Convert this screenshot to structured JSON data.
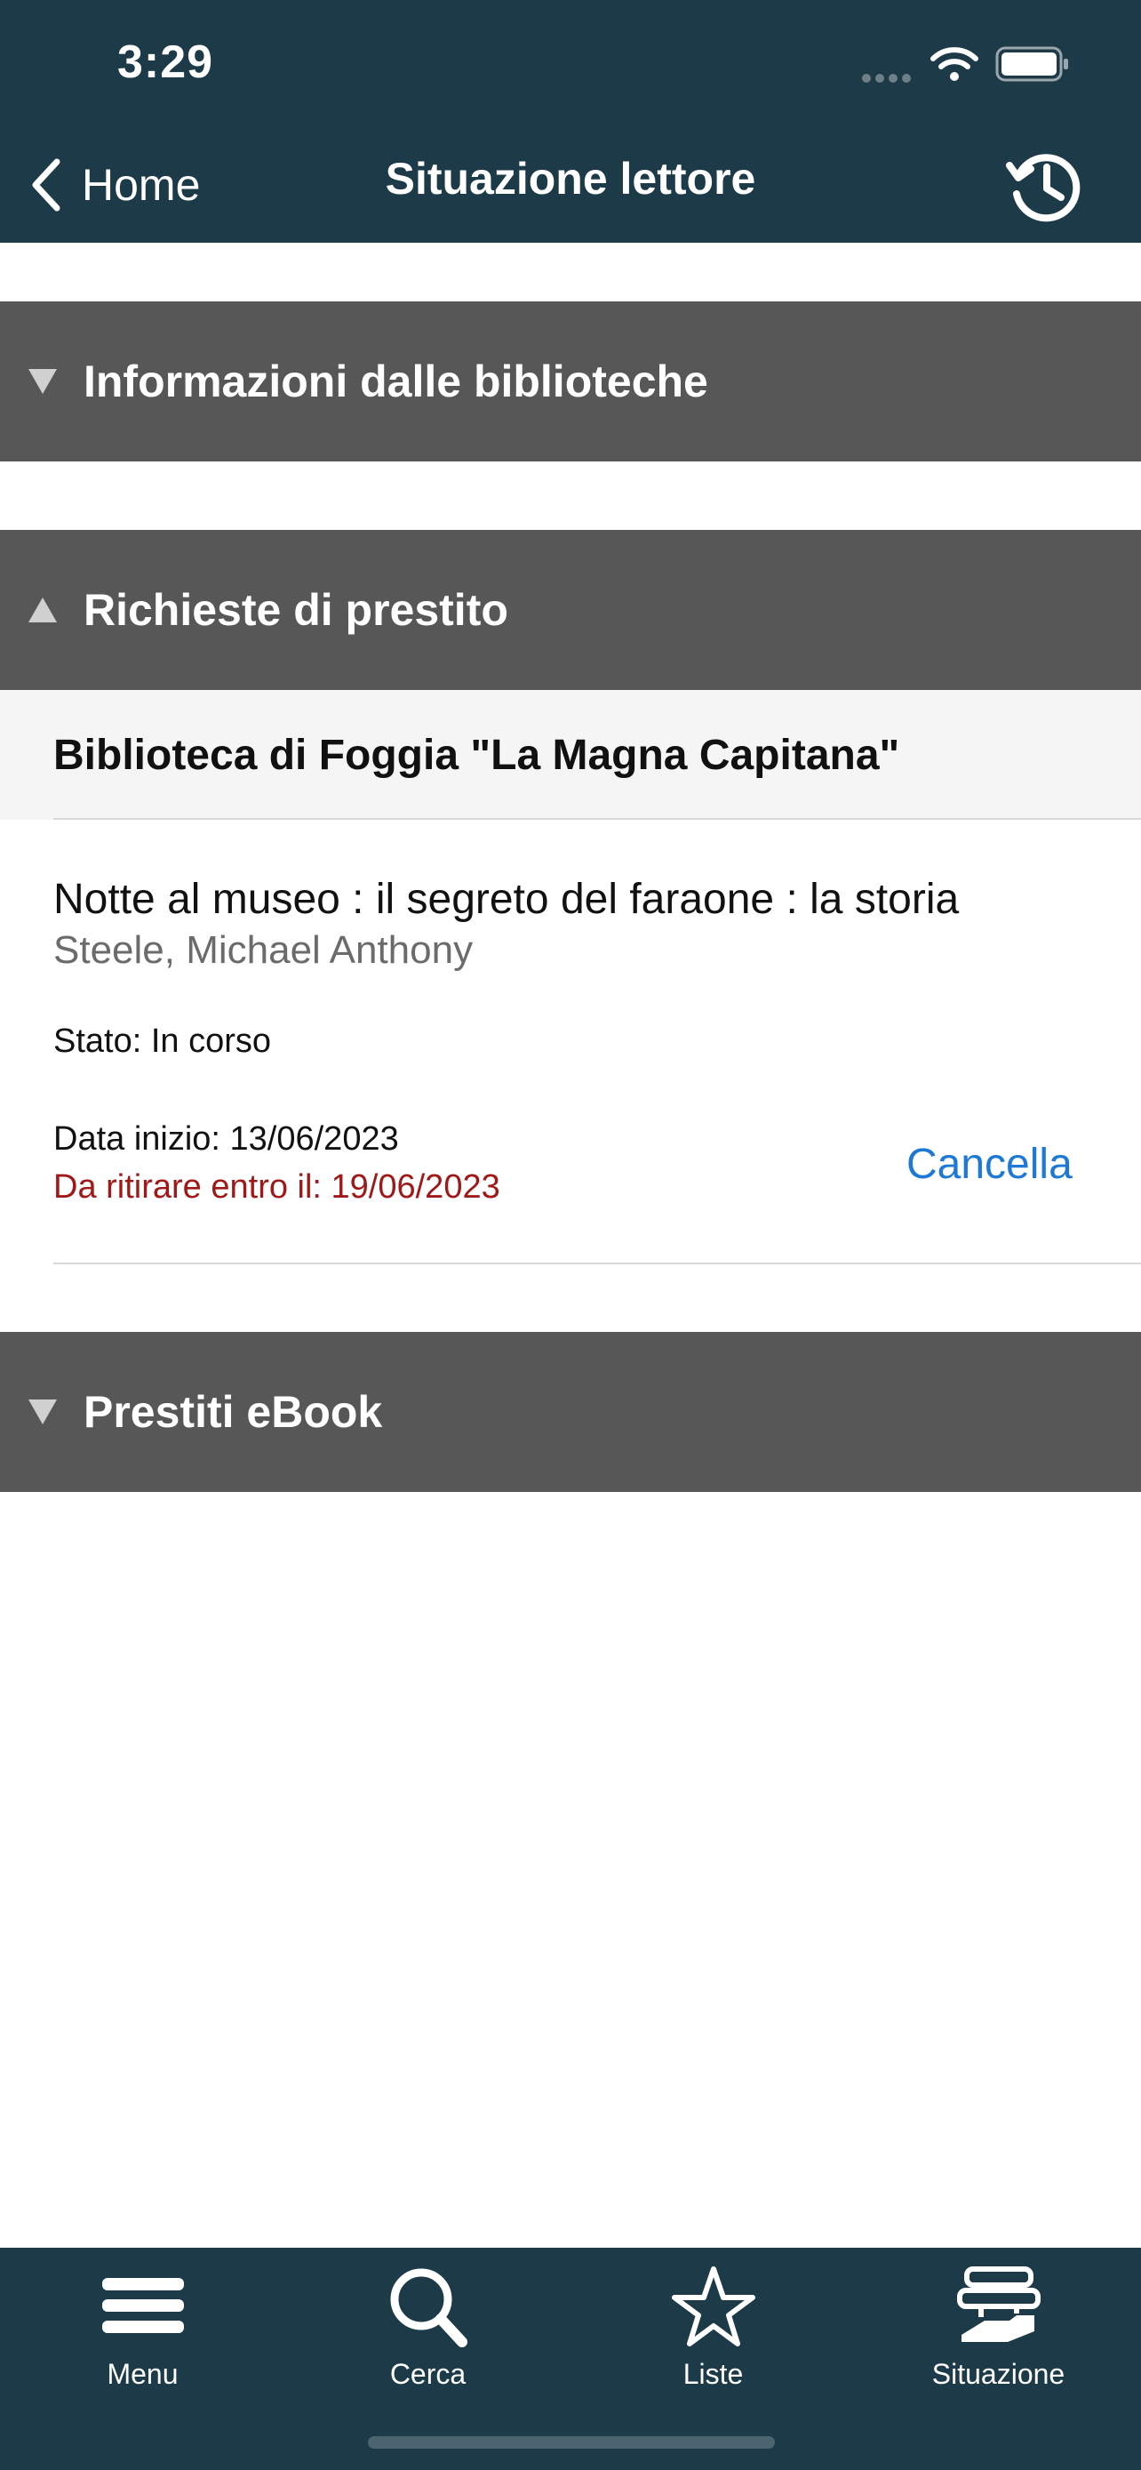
{
  "status_bar": {
    "time": "3:29"
  },
  "nav": {
    "back_label": "Home",
    "title": "Situazione lettore"
  },
  "sections": {
    "info": {
      "label": "Informazioni dalle biblioteche",
      "expanded": false
    },
    "requests": {
      "label": "Richieste di prestito",
      "expanded": true
    },
    "ebooks": {
      "label": "Prestiti eBook",
      "expanded": false
    }
  },
  "requests": {
    "library": "Biblioteca di Foggia \"La Magna Capitana\"",
    "item": {
      "title": "Notte al museo : il segreto del faraone : la storia",
      "author": "Steele, Michael Anthony",
      "status": "Stato: In corso",
      "start_date": "Data inizio: 13/06/2023",
      "pickup_by": "Da ritirare entro il: 19/06/2023",
      "cancel_label": "Cancella"
    }
  },
  "tabs": [
    {
      "label": "Menu",
      "icon": "menu-icon"
    },
    {
      "label": "Cerca",
      "icon": "search-icon"
    },
    {
      "label": "Liste",
      "icon": "star-icon"
    },
    {
      "label": "Situazione",
      "icon": "books-icon"
    }
  ],
  "colors": {
    "header_bg": "#1c3a47",
    "section_bg": "#575757",
    "accent": "#1e78d6",
    "warning": "#a01818"
  }
}
